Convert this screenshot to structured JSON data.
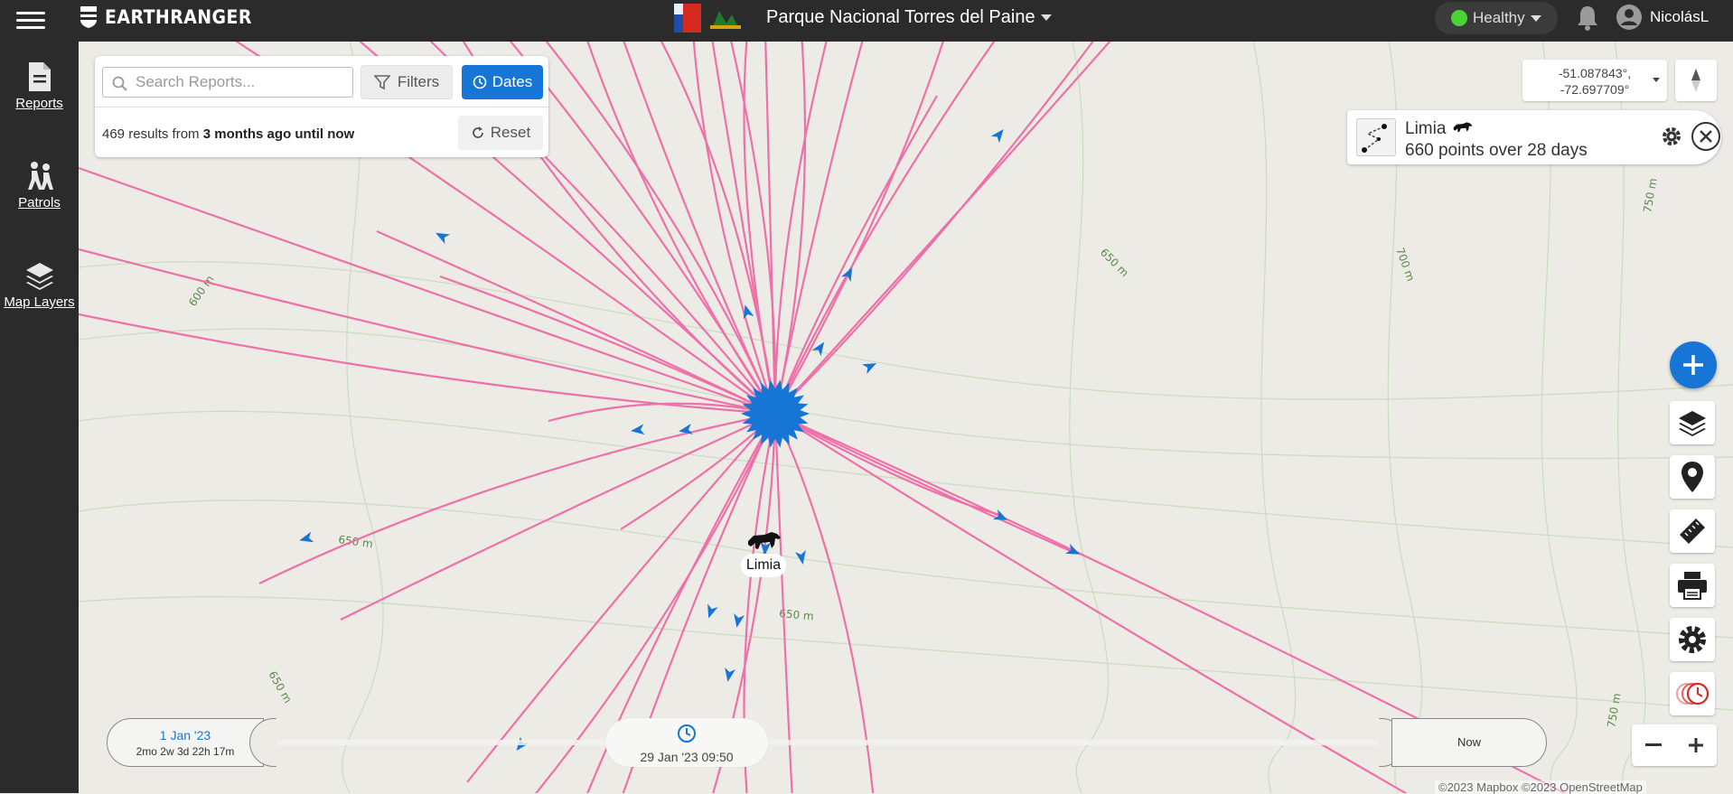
{
  "topbar": {
    "logo_text": "EARTHRANGER",
    "park_title": "Parque Nacional Torres del Paine",
    "health_status": "Healthy",
    "username": "NicolásL"
  },
  "sidebar": {
    "items": [
      {
        "label": "Reports",
        "icon": "document-icon"
      },
      {
        "label": "Patrols",
        "icon": "hikers-icon"
      },
      {
        "label": "Map Layers",
        "icon": "layers-icon"
      }
    ]
  },
  "reports_panel": {
    "search_placeholder": "Search Reports...",
    "filters_label": "Filters",
    "dates_label": "Dates",
    "results_prefix": "469 results from",
    "results_range": "3 months ago until now",
    "reset_label": "Reset"
  },
  "coordinates": {
    "lat": "-51.087843°,",
    "lon": "-72.697709°"
  },
  "track_card": {
    "name": "Limia",
    "summary": "660 points over 28 days"
  },
  "map": {
    "animal_label": "Limia",
    "contours": [
      "650 m",
      "600 m",
      "700 m",
      "750 m",
      "650 m",
      "650 m",
      "650 m",
      "750 m"
    ],
    "attribution": "©2023 Mapbox ©2023 OpenStreetMap",
    "track_color": "#ef6aa5",
    "arrow_color": "#1775d6"
  },
  "timeline": {
    "start_date": "1 Jan '23",
    "start_relative": "2mo 2w 3d 22h 17m",
    "current": "29 Jan '23 09:50",
    "end": "Now"
  }
}
